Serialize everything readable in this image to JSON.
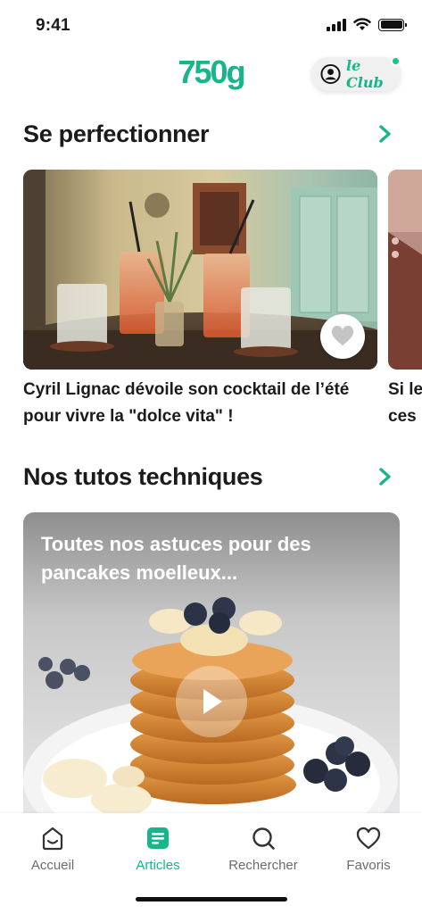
{
  "status": {
    "time": "9:41"
  },
  "header": {
    "logo": "750g",
    "club_label": "le Club"
  },
  "sections": {
    "perfectionner": {
      "title": "Se perfectionner"
    },
    "tutos": {
      "title": "Nos tutos techniques"
    }
  },
  "articles": [
    {
      "title": "Cyril Lignac dévoile son cocktail de l’été pour vivre la \"dolce vita\" !"
    },
    {
      "title": "Si le ces"
    }
  ],
  "video": {
    "title": "Toutes nos astuces pour des pancakes moelleux..."
  },
  "tabs": [
    {
      "label": "Accueil",
      "icon": "home-icon",
      "active": false
    },
    {
      "label": "Articles",
      "icon": "articles-icon",
      "active": true
    },
    {
      "label": "Rechercher",
      "icon": "search-icon",
      "active": false
    },
    {
      "label": "Favoris",
      "icon": "heart-icon",
      "active": false
    }
  ],
  "colors": {
    "accent": "#16b58a",
    "text": "#1b1b1b",
    "muted": "#6b6b6b"
  }
}
